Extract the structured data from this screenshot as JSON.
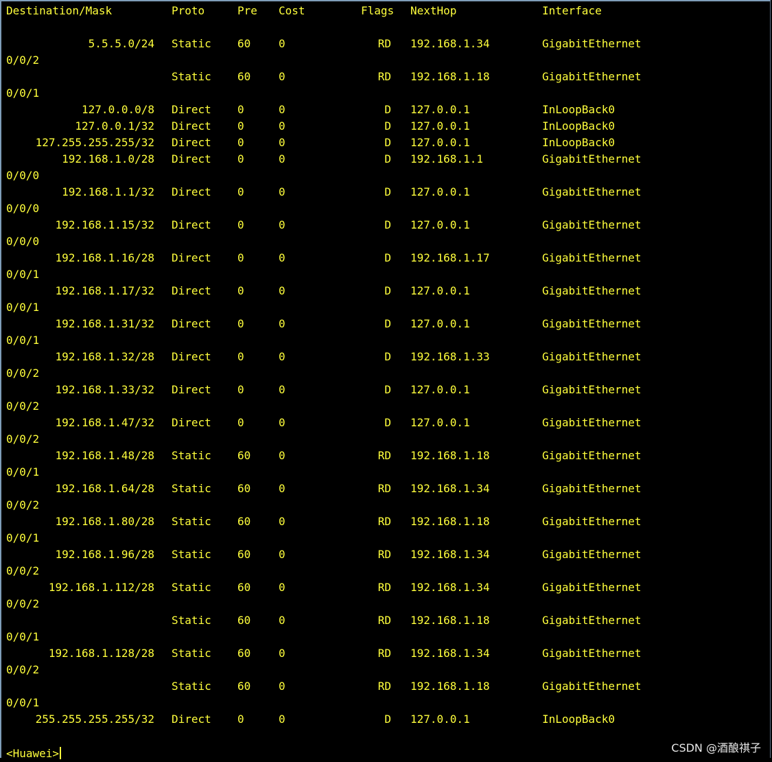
{
  "header": {
    "destination": "Destination/Mask",
    "proto": "Proto",
    "pre": "Pre",
    "cost": "Cost",
    "flags": "Flags",
    "nexthop": "NextHop",
    "interface": "Interface"
  },
  "routes": [
    {
      "dest": "5.5.5.0/24",
      "proto": "Static",
      "pre": "60",
      "cost": "0",
      "flags": "RD",
      "nexthop": "192.168.1.34",
      "iface": "GigabitEthernet",
      "wrap": "0/0/2"
    },
    {
      "dest": "",
      "proto": "Static",
      "pre": "60",
      "cost": "0",
      "flags": "RD",
      "nexthop": "192.168.1.18",
      "iface": "GigabitEthernet",
      "wrap": "0/0/1"
    },
    {
      "dest": "127.0.0.0/8",
      "proto": "Direct",
      "pre": "0",
      "cost": "0",
      "flags": "D",
      "nexthop": "127.0.0.1",
      "iface": "InLoopBack0",
      "wrap": ""
    },
    {
      "dest": "127.0.0.1/32",
      "proto": "Direct",
      "pre": "0",
      "cost": "0",
      "flags": "D",
      "nexthop": "127.0.0.1",
      "iface": "InLoopBack0",
      "wrap": ""
    },
    {
      "dest": "127.255.255.255/32",
      "proto": "Direct",
      "pre": "0",
      "cost": "0",
      "flags": "D",
      "nexthop": "127.0.0.1",
      "iface": "InLoopBack0",
      "wrap": ""
    },
    {
      "dest": "192.168.1.0/28",
      "proto": "Direct",
      "pre": "0",
      "cost": "0",
      "flags": "D",
      "nexthop": "192.168.1.1",
      "iface": "GigabitEthernet",
      "wrap": "0/0/0"
    },
    {
      "dest": "192.168.1.1/32",
      "proto": "Direct",
      "pre": "0",
      "cost": "0",
      "flags": "D",
      "nexthop": "127.0.0.1",
      "iface": "GigabitEthernet",
      "wrap": "0/0/0"
    },
    {
      "dest": "192.168.1.15/32",
      "proto": "Direct",
      "pre": "0",
      "cost": "0",
      "flags": "D",
      "nexthop": "127.0.0.1",
      "iface": "GigabitEthernet",
      "wrap": "0/0/0"
    },
    {
      "dest": "192.168.1.16/28",
      "proto": "Direct",
      "pre": "0",
      "cost": "0",
      "flags": "D",
      "nexthop": "192.168.1.17",
      "iface": "GigabitEthernet",
      "wrap": "0/0/1"
    },
    {
      "dest": "192.168.1.17/32",
      "proto": "Direct",
      "pre": "0",
      "cost": "0",
      "flags": "D",
      "nexthop": "127.0.0.1",
      "iface": "GigabitEthernet",
      "wrap": "0/0/1"
    },
    {
      "dest": "192.168.1.31/32",
      "proto": "Direct",
      "pre": "0",
      "cost": "0",
      "flags": "D",
      "nexthop": "127.0.0.1",
      "iface": "GigabitEthernet",
      "wrap": "0/0/1"
    },
    {
      "dest": "192.168.1.32/28",
      "proto": "Direct",
      "pre": "0",
      "cost": "0",
      "flags": "D",
      "nexthop": "192.168.1.33",
      "iface": "GigabitEthernet",
      "wrap": "0/0/2"
    },
    {
      "dest": "192.168.1.33/32",
      "proto": "Direct",
      "pre": "0",
      "cost": "0",
      "flags": "D",
      "nexthop": "127.0.0.1",
      "iface": "GigabitEthernet",
      "wrap": "0/0/2"
    },
    {
      "dest": "192.168.1.47/32",
      "proto": "Direct",
      "pre": "0",
      "cost": "0",
      "flags": "D",
      "nexthop": "127.0.0.1",
      "iface": "GigabitEthernet",
      "wrap": "0/0/2"
    },
    {
      "dest": "192.168.1.48/28",
      "proto": "Static",
      "pre": "60",
      "cost": "0",
      "flags": "RD",
      "nexthop": "192.168.1.18",
      "iface": "GigabitEthernet",
      "wrap": "0/0/1"
    },
    {
      "dest": "192.168.1.64/28",
      "proto": "Static",
      "pre": "60",
      "cost": "0",
      "flags": "RD",
      "nexthop": "192.168.1.34",
      "iface": "GigabitEthernet",
      "wrap": "0/0/2"
    },
    {
      "dest": "192.168.1.80/28",
      "proto": "Static",
      "pre": "60",
      "cost": "0",
      "flags": "RD",
      "nexthop": "192.168.1.18",
      "iface": "GigabitEthernet",
      "wrap": "0/0/1"
    },
    {
      "dest": "192.168.1.96/28",
      "proto": "Static",
      "pre": "60",
      "cost": "0",
      "flags": "RD",
      "nexthop": "192.168.1.34",
      "iface": "GigabitEthernet",
      "wrap": "0/0/2"
    },
    {
      "dest": "192.168.1.112/28",
      "proto": "Static",
      "pre": "60",
      "cost": "0",
      "flags": "RD",
      "nexthop": "192.168.1.34",
      "iface": "GigabitEthernet",
      "wrap": "0/0/2"
    },
    {
      "dest": "",
      "proto": "Static",
      "pre": "60",
      "cost": "0",
      "flags": "RD",
      "nexthop": "192.168.1.18",
      "iface": "GigabitEthernet",
      "wrap": "0/0/1"
    },
    {
      "dest": "192.168.1.128/28",
      "proto": "Static",
      "pre": "60",
      "cost": "0",
      "flags": "RD",
      "nexthop": "192.168.1.34",
      "iface": "GigabitEthernet",
      "wrap": "0/0/2"
    },
    {
      "dest": "",
      "proto": "Static",
      "pre": "60",
      "cost": "0",
      "flags": "RD",
      "nexthop": "192.168.1.18",
      "iface": "GigabitEthernet",
      "wrap": "0/0/1"
    },
    {
      "dest": "255.255.255.255/32",
      "proto": "Direct",
      "pre": "0",
      "cost": "0",
      "flags": "D",
      "nexthop": "127.0.0.1",
      "iface": "InLoopBack0",
      "wrap": ""
    }
  ],
  "prompt": "<Huawei>",
  "watermark": "CSDN @酒酿祺子",
  "colors": {
    "background": "#000000",
    "text": "#ffff3c"
  }
}
